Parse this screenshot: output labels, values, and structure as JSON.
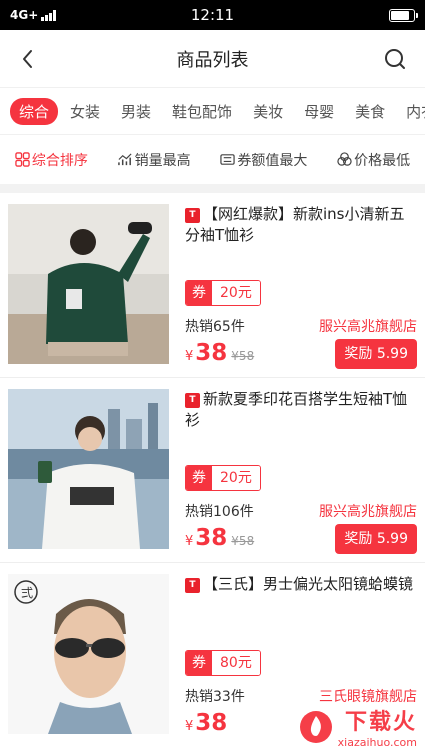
{
  "status_bar": {
    "network": "4G+",
    "time": "12:11",
    "battery_level": 0.8
  },
  "nav": {
    "title": "商品列表"
  },
  "categories": [
    "综合",
    "女装",
    "男装",
    "鞋包配饰",
    "美妆",
    "母婴",
    "美食",
    "内衣"
  ],
  "sort": {
    "items": [
      {
        "label": "综合排序",
        "icon": "grid-icon",
        "active": true
      },
      {
        "label": "销量最高",
        "icon": "trend-icon",
        "active": false
      },
      {
        "label": "券额值最大",
        "icon": "coupon-icon",
        "active": false
      },
      {
        "label": "价格最低",
        "icon": "coins-icon",
        "active": false
      }
    ]
  },
  "products": [
    {
      "badge": "T",
      "title": "【网红爆款】新款ins小清新五分袖T恤衫",
      "coupon_label": "券",
      "coupon_value": "20元",
      "sales": "热销65件",
      "shop": "服兴高兆旗舰店",
      "price_symbol": "¥",
      "price": "38",
      "original_price": "¥58",
      "reward": "奖励 5.99"
    },
    {
      "badge": "T",
      "title": "新款夏季印花百搭学生短袖T恤衫",
      "coupon_label": "券",
      "coupon_value": "20元",
      "sales": "热销106件",
      "shop": "服兴高兆旗舰店",
      "price_symbol": "¥",
      "price": "38",
      "original_price": "¥58",
      "reward": "奖励 5.99"
    },
    {
      "badge": "T",
      "title": "【三氏】男士偏光太阳镜蛤蟆镜",
      "coupon_label": "券",
      "coupon_value": "80元",
      "sales": "热销33件",
      "shop": "三氏眼镜旗舰店",
      "price_symbol": "¥",
      "price": "38",
      "original_price": "",
      "reward": ""
    }
  ],
  "watermark": {
    "main": "下载火",
    "sub": "xiazaihuo.com"
  },
  "colors": {
    "accent": "#f5343f",
    "tmall": "#e9222c"
  }
}
